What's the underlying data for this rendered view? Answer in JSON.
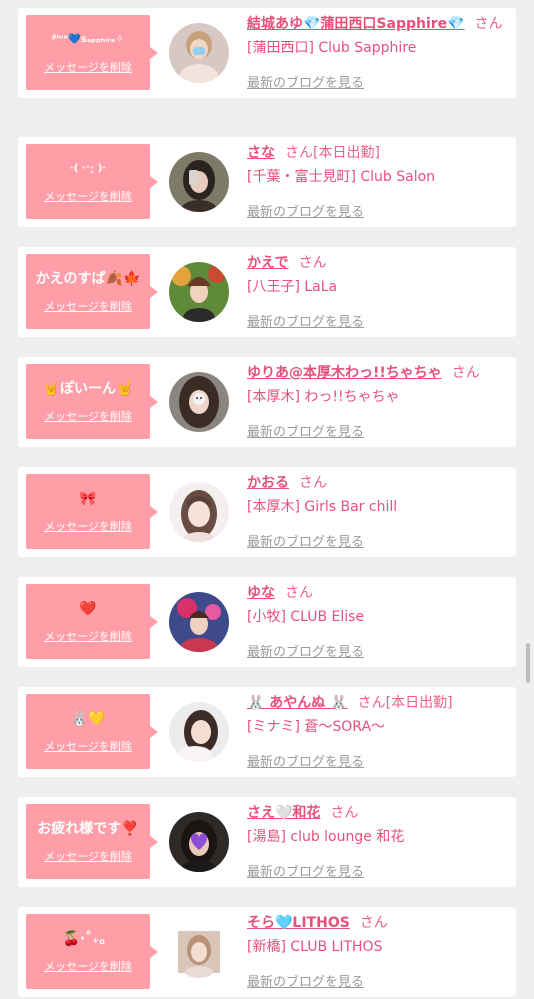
{
  "items": [
    {
      "message": "ᵝˡᵘᵉ💙sₐₚₚₕᵢᵣₑ✧",
      "delete_label": "メッセージを削除",
      "name": "結城あゆ💎蒲田西口Sapphire💎",
      "honorific": "さん",
      "status": "",
      "shop": "[蒲田西口] Club Sapphire",
      "blog_link": "最新のブログを見る"
    },
    {
      "message": "·( ·ᵕ·̥ )·",
      "delete_label": "メッセージを削除",
      "name": "さな",
      "honorific": "さん",
      "status": "[本日出勤]",
      "shop": "[千葉・富士見町] Club Salon",
      "blog_link": "最新のブログを見る"
    },
    {
      "message": "かえのすぱ🍂🍁",
      "delete_label": "メッセージを削除",
      "name": "かえで",
      "honorific": "さん",
      "status": "",
      "shop": "[八王子] LaLa",
      "blog_link": "最新のブログを見る"
    },
    {
      "message": "🤘ぽいーん🤘",
      "delete_label": "メッセージを削除",
      "name": "ゆりあ@本厚木わっ!!ちゃちゃ",
      "honorific": "さん",
      "status": "",
      "shop": "[本厚木] わっ!!ちゃちゃ",
      "blog_link": "最新のブログを見る"
    },
    {
      "message": "🎀",
      "delete_label": "メッセージを削除",
      "name": "かおる",
      "honorific": "さん",
      "status": "",
      "shop": "[本厚木] Girls Bar chill",
      "blog_link": "最新のブログを見る"
    },
    {
      "message": "❤️",
      "delete_label": "メッセージを削除",
      "name": "ゆな",
      "honorific": "さん",
      "status": "",
      "shop": "[小牧] CLUB Elise",
      "blog_link": "最新のブログを見る"
    },
    {
      "message": "🐰💛",
      "delete_label": "メッセージを削除",
      "name": "🐰 あやんぬ 🐰",
      "honorific": "さん",
      "status": "[本日出勤]",
      "shop": "[ミナミ] 蒼〜SORA〜",
      "blog_link": "最新のブログを見る"
    },
    {
      "message": "お疲れ様です❣️",
      "delete_label": "メッセージを削除",
      "name": "さえ🤍和花",
      "honorific": "さん",
      "status": "",
      "shop": "[湯島] club lounge 和花",
      "blog_link": "最新のブログを見る"
    },
    {
      "message": "🍒‧˚₊。",
      "delete_label": "メッセージを削除",
      "name": "そら🩵LITHOS",
      "honorific": "さん",
      "status": "",
      "shop": "[新橋] CLUB LITHOS",
      "blog_link": "最新のブログを見る"
    }
  ]
}
